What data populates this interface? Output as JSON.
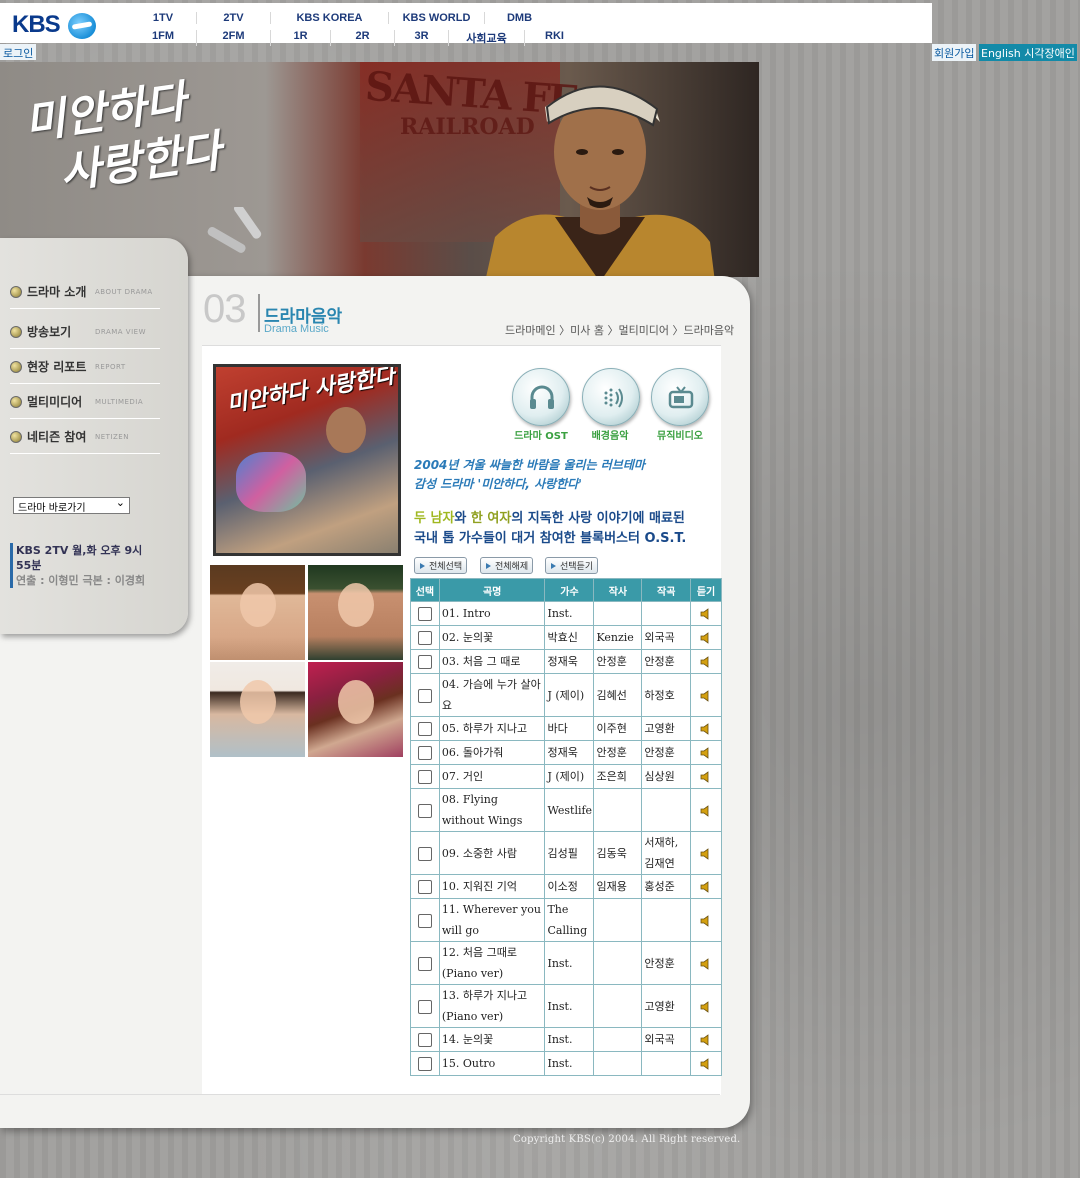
{
  "brand": {
    "logo": "KBS"
  },
  "topnav": {
    "row1": [
      "1TV",
      "2TV",
      "KBS KOREA",
      "KBS WORLD",
      "DMB"
    ],
    "row2": [
      "1FM",
      "2FM",
      "1R",
      "2R",
      "3R",
      "사회교육",
      "RKI"
    ]
  },
  "util": {
    "login": "로그인",
    "join": "회원가입",
    "english": "English 시각장애인"
  },
  "banner": {
    "title_line1": "미안하다",
    "title_line2": "사랑한다",
    "wall_text1": "SANTA FE",
    "wall_text2": "RAILROAD"
  },
  "sidebar": {
    "items": [
      {
        "label": "드라마 소개",
        "en": "ABOUT DRAMA"
      },
      {
        "label": "방송보기",
        "en": "DRAMA VIEW"
      },
      {
        "label": "현장 리포트",
        "en": "REPORT"
      },
      {
        "label": "멀티미디어",
        "en": "MULTIMEDIA"
      },
      {
        "label": "네티즌 참여",
        "en": "NETIZEN"
      }
    ],
    "select": "드라마 바로가기",
    "airtime": "KBS 2TV 월,화 오후 9시 55분",
    "credits": "연출 : 이형민  극본 : 이경희"
  },
  "section": {
    "number": "03",
    "title": "드라마음악",
    "subtitle": "Drama Music",
    "breadcrumb": "드라마메인 〉미사 홈 〉멀티미디어 〉드라마음악"
  },
  "poster": {
    "title": "미안하다 사랑한다"
  },
  "music_buttons": [
    {
      "label": "드라마 OST",
      "icon": "headphones-icon"
    },
    {
      "label": "배경음악",
      "icon": "speaker-icon"
    },
    {
      "label": "뮤직비디오",
      "icon": "tv-icon"
    }
  ],
  "promo": {
    "line1": "2004년 겨울 싸늘한 바람을 울리는 러브테마",
    "line2": "감성 드라마 '미안하다, 사랑한다'",
    "line3_a": "두 남자",
    "line3_b": "와 ",
    "line3_c": "한 여자",
    "line3_d": "의 지독한 사랑 이야기에 매료된",
    "line4": "국내 톱 가수들이 대거 참여한 블록버스터 O.S.T."
  },
  "actions": {
    "select_all": "전체선택",
    "clear_all": "전체해제",
    "listen_selected": "선택듣기"
  },
  "table": {
    "headers": [
      "선택",
      "곡명",
      "가수",
      "작사",
      "작곡",
      "듣기"
    ],
    "rows": [
      {
        "title": "01. Intro",
        "singer": "Inst.",
        "lyric": "",
        "composer": ""
      },
      {
        "title": "02. 눈의꽃",
        "singer": "박효신",
        "lyric": "Kenzie",
        "composer": "외국곡"
      },
      {
        "title": "03. 처음 그 때로",
        "singer": "정재욱",
        "lyric": "안정훈",
        "composer": "안정훈"
      },
      {
        "title": "04. 가슴에 누가 살아요",
        "singer": "J (제이)",
        "lyric": "김혜선",
        "composer": "하정호"
      },
      {
        "title": "05. 하루가 지나고",
        "singer": "바다",
        "lyric": "이주현",
        "composer": "고영환"
      },
      {
        "title": "06. 돌아가줘",
        "singer": "정재욱",
        "lyric": "안정훈",
        "composer": "안정훈"
      },
      {
        "title": "07. 거인",
        "singer": "J (제이)",
        "lyric": "조은희",
        "composer": "심상원"
      },
      {
        "title": "08. Flying without Wings",
        "singer": "Westlife",
        "lyric": "",
        "composer": ""
      },
      {
        "title": "09. 소중한 사람",
        "singer": "김성필",
        "lyric": "김동욱",
        "composer": "서재하, 김재연"
      },
      {
        "title": "10. 지워진 기억",
        "singer": "이소정",
        "lyric": "임재용",
        "composer": "홍성준"
      },
      {
        "title": "11. Wherever you will go",
        "singer": "The Calling",
        "lyric": "",
        "composer": ""
      },
      {
        "title": "12. 처음 그때로 (Piano ver)",
        "singer": "Inst.",
        "lyric": "",
        "composer": "안정훈"
      },
      {
        "title": "13. 하루가 지나고 (Piano ver)",
        "singer": "Inst.",
        "lyric": "",
        "composer": "고영환"
      },
      {
        "title": "14. 눈의꽃",
        "singer": "Inst.",
        "lyric": "",
        "composer": "외국곡"
      },
      {
        "title": "15. Outro",
        "singer": "Inst.",
        "lyric": "",
        "composer": ""
      }
    ]
  },
  "footer": {
    "copyright": "Copyright KBS(c) 2004. All Right reserved."
  },
  "colors": {
    "accent": "#3a9aa8",
    "brand_blue": "#0a3a8c",
    "green_label": "#3aa040"
  }
}
